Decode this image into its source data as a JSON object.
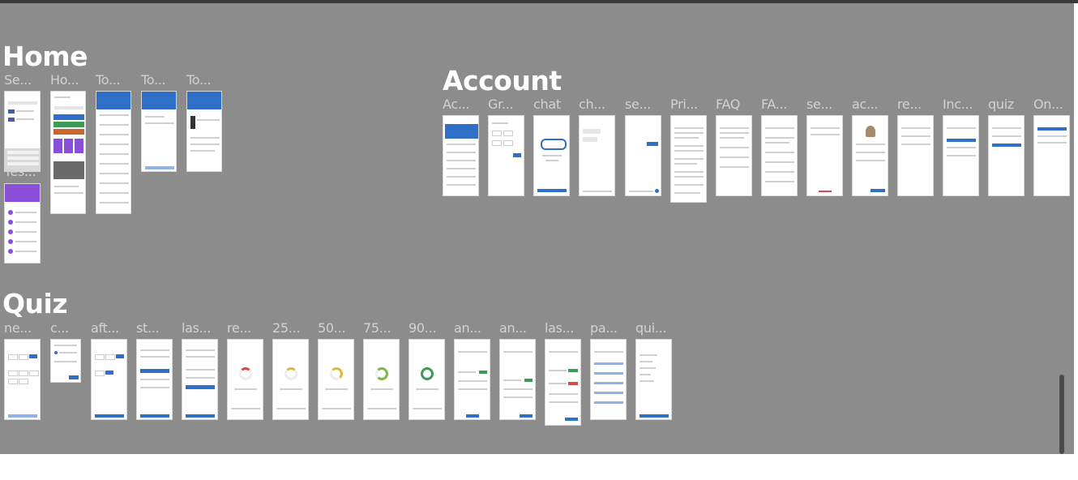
{
  "sections": {
    "home": {
      "title": "Home",
      "frames": [
        "Se...",
        "Ho...",
        "To...",
        "To...",
        "To..."
      ],
      "sub_frame": "Yes..."
    },
    "account": {
      "title": "Account",
      "frames": [
        "Ac...",
        "Gr...",
        "chat",
        "ch...",
        "se...",
        "Pri...",
        "FAQ",
        "FA...",
        "se...",
        "ac...",
        "re...",
        "Inc...",
        "quiz",
        "On..."
      ]
    },
    "quiz": {
      "title": "Quiz",
      "frames": [
        "ne...",
        "c...",
        "aft...",
        "st...",
        "las...",
        "re...",
        "25...",
        "50...",
        "75...",
        "90...",
        "an...",
        "an...",
        "las...",
        "pa...",
        "qui..."
      ]
    }
  },
  "colors": {
    "canvas": "#8c8c8c",
    "frame": "#ffffff",
    "accent_blue": "#2f6fc7",
    "accent_purple": "#8a4fd8",
    "accent_orange": "#c9652f",
    "accent_green": "#3f9a5a",
    "ring_yellow": "#e0b93a",
    "label": "#d2d2d2"
  }
}
